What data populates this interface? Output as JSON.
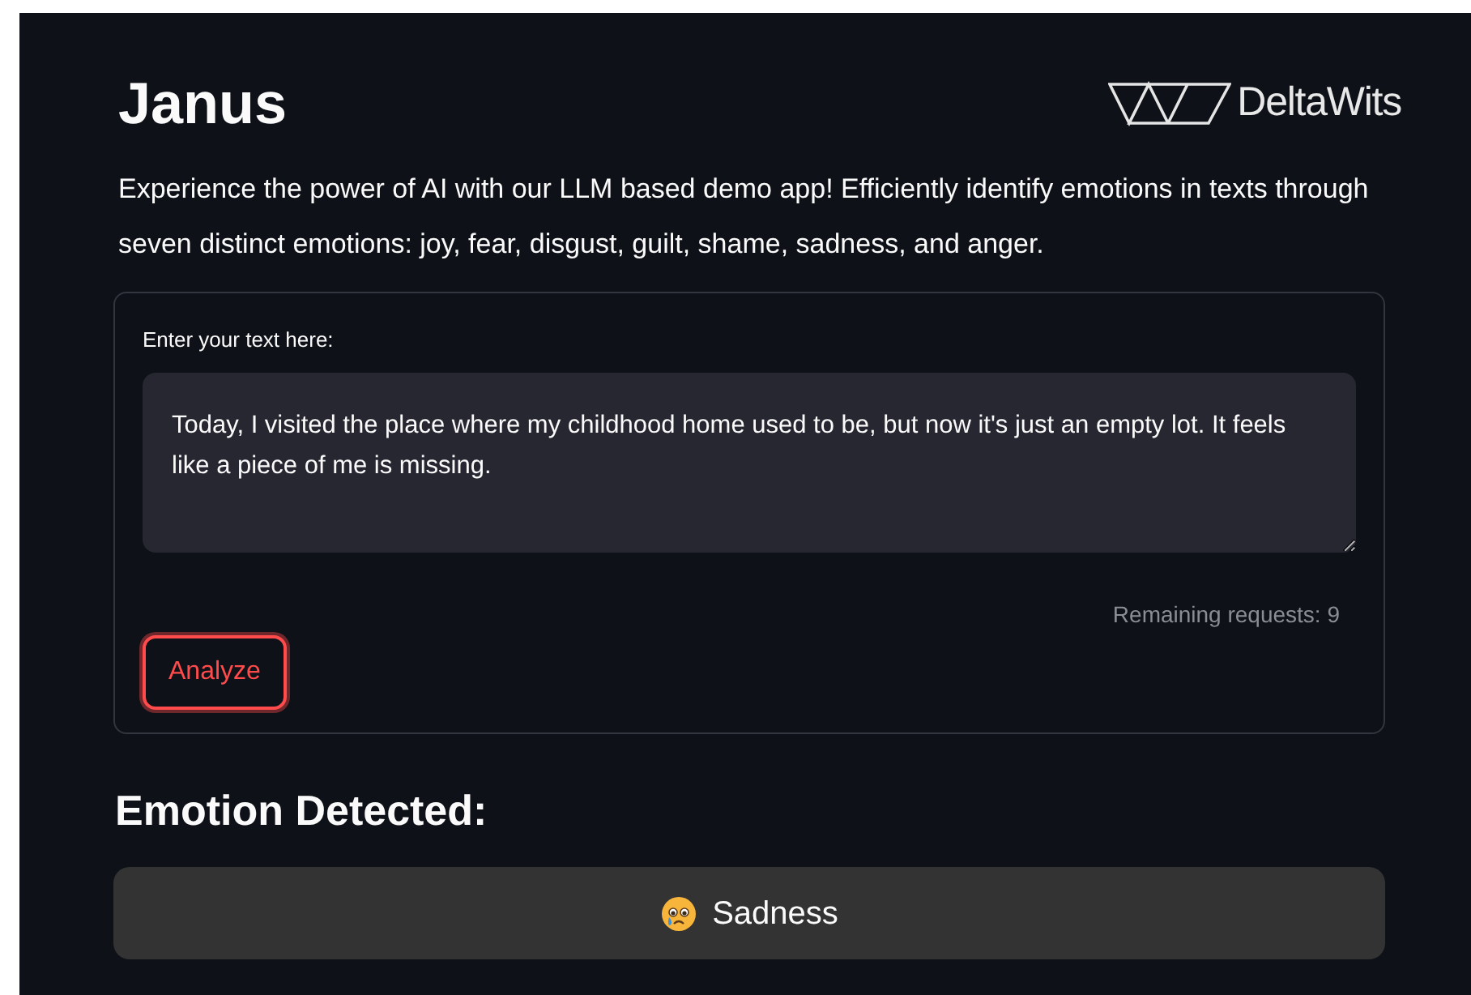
{
  "header": {
    "title": "Janus",
    "logo_text": "DeltaWits"
  },
  "description": "Experience the power of AI with our LLM based demo app! Efficiently identify emotions in texts through seven distinct emotions: joy, fear, disgust, guilt, shame, sadness, and anger.",
  "form": {
    "label": "Enter your text here:",
    "value": "Today, I visited the place where my childhood home used to be, but now it's just an empty lot. It feels like a piece of me is missing.",
    "remaining": "Remaining requests: 9",
    "button": "Analyze"
  },
  "result": {
    "heading": "Emotion Detected:",
    "emotion": "Sadness"
  }
}
